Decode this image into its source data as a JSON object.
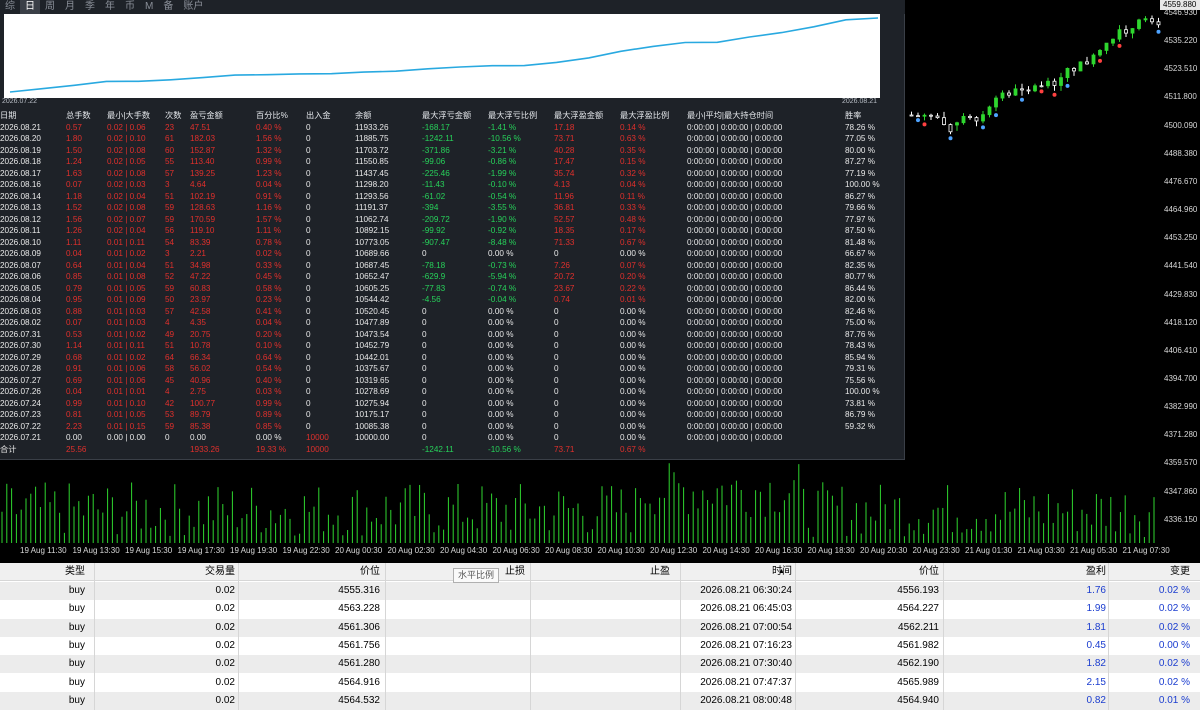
{
  "chart": {
    "current_price": "4559.880",
    "price_labels": [
      "4546.930",
      "4535.220",
      "4523.510",
      "4511.800",
      "4500.090",
      "4488.380",
      "4476.670",
      "4464.960",
      "4453.250",
      "4441.540",
      "4429.830",
      "4418.120",
      "4406.410",
      "4394.700",
      "4382.990",
      "4371.280",
      "4359.570",
      "4347.860",
      "4336.150"
    ],
    "time_labels": [
      "19 Aug 11:30",
      "19 Aug 13:30",
      "19 Aug 15:30",
      "19 Aug 17:30",
      "19 Aug 19:30",
      "19 Aug 22:30",
      "20 Aug 00:30",
      "20 Aug 02:30",
      "20 Aug 04:30",
      "20 Aug 06:30",
      "20 Aug 08:30",
      "20 Aug 10:30",
      "20 Aug 12:30",
      "20 Aug 14:30",
      "20 Aug 16:30",
      "20 Aug 18:30",
      "20 Aug 20:30",
      "20 Aug 23:30",
      "21 Aug 01:30",
      "21 Aug 03:30",
      "21 Aug 05:30",
      "21 Aug 07:30"
    ],
    "colors": {
      "bull": "#2fd62f",
      "bear": "#ffffff",
      "volume": "#2fd62f",
      "marker_buy": "#4ea3ff",
      "marker_sell": "#ff4040"
    }
  },
  "panel": {
    "tabs": [
      "综",
      "日",
      "周",
      "月",
      "季",
      "年",
      "币",
      "M",
      "备",
      "账户"
    ],
    "active_tab": 1,
    "equity_start_date": "2026.07.22",
    "equity_end_date": "2026.08.21",
    "equity_line_color": "#29a9e0",
    "headers": [
      "日期",
      "总手数",
      "最小|大手数",
      "次数",
      "盈亏金额",
      "百分比%",
      "出入金",
      "余额",
      "最大浮亏金额",
      "最大浮亏比例",
      "最大浮盈金额",
      "最大浮盈比例",
      "最小|平均|最大持仓时间",
      "胜率"
    ],
    "rows": [
      [
        "2026.08.21",
        "0.57",
        "0.02 | 0.06",
        "23",
        "47.51",
        "0.40 %",
        "0",
        "11933.26",
        "-168.17",
        "-1.41 %",
        "17.18",
        "0.14 %",
        "0:00:00 | 0:00:00 | 0:00:00",
        "78.26 %"
      ],
      [
        "2026.08.20",
        "1.80",
        "0.02 | 0.10",
        "61",
        "182.03",
        "1.56 %",
        "0",
        "11885.75",
        "-1242.11",
        "-10.56 %",
        "73.71",
        "0.63 %",
        "0:00:00 | 0:00:00 | 0:00:00",
        "77.05 %"
      ],
      [
        "2026.08.19",
        "1.50",
        "0.02 | 0.08",
        "60",
        "152.87",
        "1.32 %",
        "0",
        "11703.72",
        "-371.86",
        "-3.21 %",
        "40.28",
        "0.35 %",
        "0:00:00 | 0:00:00 | 0:00:00",
        "80.00 %"
      ],
      [
        "2026.08.18",
        "1.24",
        "0.02 | 0.05",
        "55",
        "113.40",
        "0.99 %",
        "0",
        "11550.85",
        "-99.06",
        "-0.86 %",
        "17.47",
        "0.15 %",
        "0:00:00 | 0:00:00 | 0:00:00",
        "87.27 %"
      ],
      [
        "2026.08.17",
        "1.63",
        "0.02 | 0.08",
        "57",
        "139.25",
        "1.23 %",
        "0",
        "11437.45",
        "-225.46",
        "-1.99 %",
        "35.74",
        "0.32 %",
        "0:00:00 | 0:00:00 | 0:00:00",
        "77.19 %"
      ],
      [
        "2026.08.16",
        "0.07",
        "0.02 | 0.03",
        "3",
        "4.64",
        "0.04 %",
        "0",
        "11298.20",
        "-11.43",
        "-0.10 %",
        "4.13",
        "0.04 %",
        "0:00:00 | 0:00:00 | 0:00:00",
        "100.00 %"
      ],
      [
        "2026.08.14",
        "1.18",
        "0.02 | 0.04",
        "51",
        "102.19",
        "0.91 %",
        "0",
        "11293.56",
        "-61.02",
        "-0.54 %",
        "11.96",
        "0.11 %",
        "0:00:00 | 0:00:00 | 0:00:00",
        "86.27 %"
      ],
      [
        "2026.08.13",
        "1.52",
        "0.02 | 0.08",
        "59",
        "128.63",
        "1.16 %",
        "0",
        "11191.37",
        "-394",
        "-3.55 %",
        "36.81",
        "0.33 %",
        "0:00:00 | 0:00:00 | 0:00:00",
        "79.66 %"
      ],
      [
        "2026.08.12",
        "1.56",
        "0.02 | 0.07",
        "59",
        "170.59",
        "1.57 %",
        "0",
        "11062.74",
        "-209.72",
        "-1.90 %",
        "52.57",
        "0.48 %",
        "0:00:00 | 0:00:00 | 0:00:00",
        "77.97 %"
      ],
      [
        "2026.08.11",
        "1.26",
        "0.02 | 0.04",
        "56",
        "119.10",
        "1.11 %",
        "0",
        "10892.15",
        "-99.92",
        "-0.92 %",
        "18.35",
        "0.17 %",
        "0:00:00 | 0:00:00 | 0:00:00",
        "87.50 %"
      ],
      [
        "2026.08.10",
        "1.11",
        "0.01 | 0.11",
        "54",
        "83.39",
        "0.78 %",
        "0",
        "10773.05",
        "-907.47",
        "-8.48 %",
        "71.33",
        "0.67 %",
        "0:00:00 | 0:00:00 | 0:00:00",
        "81.48 %"
      ],
      [
        "2026.08.09",
        "0.04",
        "0.01 | 0.02",
        "3",
        "2.21",
        "0.02 %",
        "0",
        "10689.66",
        "0",
        "0.00 %",
        "0",
        "0.00 %",
        "0:00:00 | 0:00:00 | 0:00:00",
        "66.67 %"
      ],
      [
        "2026.08.07",
        "0.64",
        "0.01 | 0.04",
        "51",
        "34.98",
        "0.33 %",
        "0",
        "10687.45",
        "-78.18",
        "-0.73 %",
        "7.26",
        "0.07 %",
        "0:00:00 | 0:00:00 | 0:00:00",
        "82.35 %"
      ],
      [
        "2026.08.06",
        "0.85",
        "0.01 | 0.08",
        "52",
        "47.22",
        "0.45 %",
        "0",
        "10652.47",
        "-629.9",
        "-5.94 %",
        "20.72",
        "0.20 %",
        "0:00:00 | 0:00:00 | 0:00:00",
        "80.77 %"
      ],
      [
        "2026.08.05",
        "0.79",
        "0.01 | 0.05",
        "59",
        "60.83",
        "0.58 %",
        "0",
        "10605.25",
        "-77.83",
        "-0.74 %",
        "23.67",
        "0.22 %",
        "0:00:00 | 0:00:00 | 0:00:00",
        "86.44 %"
      ],
      [
        "2026.08.04",
        "0.95",
        "0.01 | 0.09",
        "50",
        "23.97",
        "0.23 %",
        "0",
        "10544.42",
        "-4.56",
        "-0.04 %",
        "0.74",
        "0.01 %",
        "0:00:00 | 0:00:00 | 0:00:00",
        "82.00 %"
      ],
      [
        "2026.08.03",
        "0.88",
        "0.01 | 0.03",
        "57",
        "42.58",
        "0.41 %",
        "0",
        "10520.45",
        "0",
        "0.00 %",
        "0",
        "0.00 %",
        "0:00:00 | 0:00:00 | 0:00:00",
        "82.46 %"
      ],
      [
        "2026.08.02",
        "0.07",
        "0.01 | 0.03",
        "4",
        "4.35",
        "0.04 %",
        "0",
        "10477.89",
        "0",
        "0.00 %",
        "0",
        "0.00 %",
        "0:00:00 | 0:00:00 | 0:00:00",
        "75.00 %"
      ],
      [
        "2026.07.31",
        "0.53",
        "0.01 | 0.02",
        "49",
        "20.75",
        "0.20 %",
        "0",
        "10473.54",
        "0",
        "0.00 %",
        "0",
        "0.00 %",
        "0:00:00 | 0:00:00 | 0:00:00",
        "87.76 %"
      ],
      [
        "2026.07.30",
        "1.14",
        "0.01 | 0.11",
        "51",
        "10.78",
        "0.10 %",
        "0",
        "10452.79",
        "0",
        "0.00 %",
        "0",
        "0.00 %",
        "0:00:00 | 0:00:00 | 0:00:00",
        "78.43 %"
      ],
      [
        "2026.07.29",
        "0.68",
        "0.01 | 0.02",
        "64",
        "66.34",
        "0.64 %",
        "0",
        "10442.01",
        "0",
        "0.00 %",
        "0",
        "0.00 %",
        "0:00:00 | 0:00:00 | 0:00:00",
        "85.94 %"
      ],
      [
        "2026.07.28",
        "0.91",
        "0.01 | 0.06",
        "58",
        "56.02",
        "0.54 %",
        "0",
        "10375.67",
        "0",
        "0.00 %",
        "0",
        "0.00 %",
        "0:00:00 | 0:00:00 | 0:00:00",
        "79.31 %"
      ],
      [
        "2026.07.27",
        "0.69",
        "0.01 | 0.06",
        "45",
        "40.96",
        "0.40 %",
        "0",
        "10319.65",
        "0",
        "0.00 %",
        "0",
        "0.00 %",
        "0:00:00 | 0:00:00 | 0:00:00",
        "75.56 %"
      ],
      [
        "2026.07.26",
        "0.04",
        "0.01 | 0.01",
        "4",
        "2.75",
        "0.03 %",
        "0",
        "10278.69",
        "0",
        "0.00 %",
        "0",
        "0.00 %",
        "0:00:00 | 0:00:00 | 0:00:00",
        "100.00 %"
      ],
      [
        "2026.07.24",
        "0.99",
        "0.01 | 0.10",
        "42",
        "100.77",
        "0.99 %",
        "0",
        "10275.94",
        "0",
        "0.00 %",
        "0",
        "0.00 %",
        "0:00:00 | 0:00:00 | 0:00:00",
        "73.81 %"
      ],
      [
        "2026.07.23",
        "0.81",
        "0.01 | 0.05",
        "53",
        "89.79",
        "0.89 %",
        "0",
        "10175.17",
        "0",
        "0.00 %",
        "0",
        "0.00 %",
        "0:00:00 | 0:00:00 | 0:00:00",
        "86.79 %"
      ],
      [
        "2026.07.22",
        "2.23",
        "0.01 | 0.15",
        "59",
        "85.38",
        "0.85 %",
        "0",
        "10085.38",
        "0",
        "0.00 %",
        "0",
        "0.00 %",
        "0:00:00 | 0:00:00 | 0:00:00",
        "59.32 %"
      ],
      [
        "2026.07.21",
        "0.00",
        "0.00 | 0.00",
        "0",
        "0.00",
        "0.00 %",
        "10000",
        "10000.00",
        "0",
        "0.00 %",
        "0",
        "0.00 %",
        "0:00:00 | 0:00:00 | 0:00:00",
        ""
      ]
    ],
    "total": [
      "合计",
      "25.56",
      "",
      "",
      "1933.26",
      "19.33 %",
      "10000",
      "",
      "-1242.11",
      "-10.56 %",
      "73.71",
      "0.67 %",
      "",
      ""
    ]
  },
  "trades": {
    "tooltip": "水平比例",
    "sort_indicator": "▲",
    "headers": [
      "类型",
      "交易量",
      "价位",
      "止损",
      "止盈",
      "时间",
      "价位",
      "盈利",
      "变更"
    ],
    "rows": [
      [
        "buy",
        "0.02",
        "4555.316",
        "",
        "",
        "2026.08.21 06:30:24",
        "4556.193",
        "1.76",
        "0.02 %"
      ],
      [
        "buy",
        "0.02",
        "4563.228",
        "",
        "",
        "2026.08.21 06:45:03",
        "4564.227",
        "1.99",
        "0.02 %"
      ],
      [
        "buy",
        "0.02",
        "4561.306",
        "",
        "",
        "2026.08.21 07:00:54",
        "4562.211",
        "1.81",
        "0.02 %"
      ],
      [
        "buy",
        "0.02",
        "4561.756",
        "",
        "",
        "2026.08.21 07:16:23",
        "4561.982",
        "0.45",
        "0.00 %"
      ],
      [
        "buy",
        "0.02",
        "4561.280",
        "",
        "",
        "2026.08.21 07:30:40",
        "4562.190",
        "1.82",
        "0.02 %"
      ],
      [
        "buy",
        "0.02",
        "4564.916",
        "",
        "",
        "2026.08.21 07:47:37",
        "4565.989",
        "2.15",
        "0.02 %"
      ],
      [
        "buy",
        "0.02",
        "4564.532",
        "",
        "",
        "2026.08.21 08:00:48",
        "4564.940",
        "0.82",
        "0.01 %"
      ]
    ]
  }
}
